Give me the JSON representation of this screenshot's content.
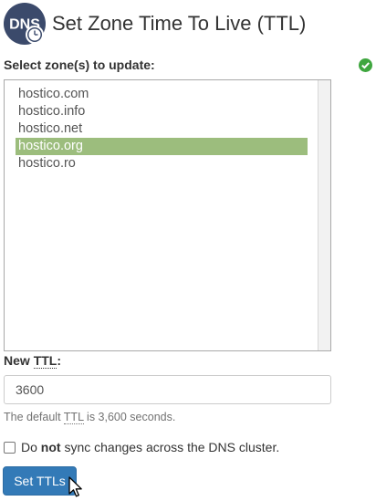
{
  "header": {
    "logo_text": "DNS",
    "logo_icon": "dns-clock-icon",
    "title": "Set Zone Time To Live (TTL)"
  },
  "status": {
    "icon": "check-circle-icon",
    "color": "#3fa63f"
  },
  "zones": {
    "label": "Select zone(s) to update:",
    "items": [
      {
        "label": "hostico.com",
        "selected": false
      },
      {
        "label": "hostico.info",
        "selected": false
      },
      {
        "label": "hostico.net",
        "selected": false
      },
      {
        "label": "hostico.org",
        "selected": true
      },
      {
        "label": "hostico.ro",
        "selected": false
      }
    ],
    "selected_color": "#9cbd7d"
  },
  "ttl": {
    "label_prefix": "New ",
    "label_abbr": "TTL",
    "label_suffix": ":",
    "value": "3600",
    "help_prefix": "The default ",
    "help_abbr": "TTL",
    "help_suffix": " is 3,600 seconds."
  },
  "sync": {
    "checked": false,
    "label_before": "Do ",
    "label_bold": "not",
    "label_after": " sync changes across the DNS cluster."
  },
  "actions": {
    "submit_label": "Set TTLs",
    "submit_color": "#337ab7"
  },
  "cursor": {
    "icon": "mouse-pointer-icon"
  }
}
